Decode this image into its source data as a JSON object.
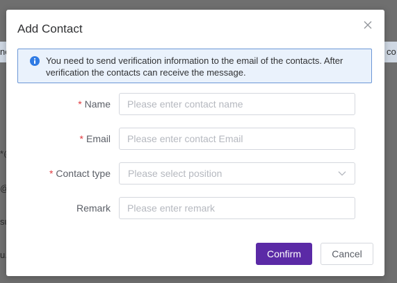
{
  "background": {
    "fragments": [
      "nc",
      "co",
      "*@",
      "@",
      "su",
      "u."
    ]
  },
  "modal": {
    "title": "Add Contact",
    "notice": "You need to send verification information to the email of the contacts. After verification the contacts can receive the message.",
    "fields": {
      "name": {
        "required_mark": "*",
        "label": "Name",
        "placeholder": "Please enter contact name"
      },
      "email": {
        "required_mark": "*",
        "label": "Email",
        "placeholder": "Please enter contact Email"
      },
      "contact_type": {
        "required_mark": "*",
        "label": "Contact type",
        "placeholder": "Please select position"
      },
      "remark": {
        "label": "Remark",
        "placeholder": "Please enter remark"
      }
    },
    "buttons": {
      "confirm": "Confirm",
      "cancel": "Cancel"
    }
  },
  "colors": {
    "primary": "#5b2aa6",
    "required": "#e0393e",
    "notice_bg": "#eaf2fc",
    "notice_border": "#6a96d6",
    "info_icon": "#2f7be4"
  }
}
